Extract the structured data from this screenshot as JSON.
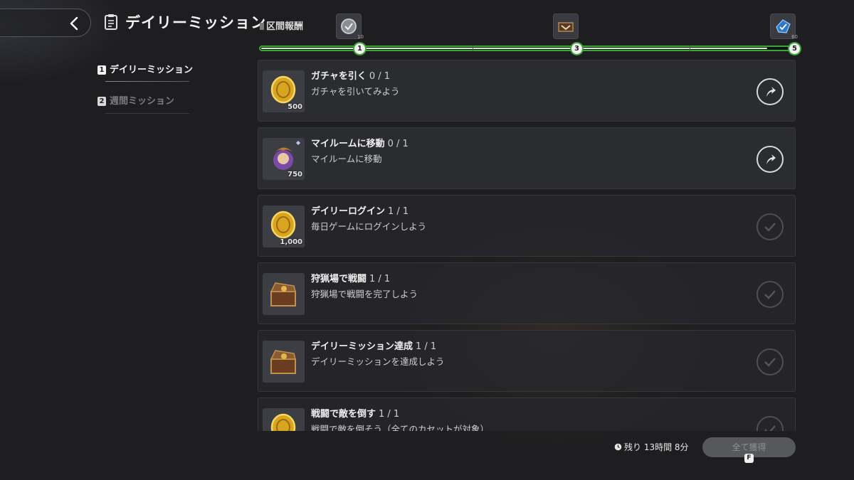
{
  "header": {
    "title": "デイリーミッション",
    "section_label": "区間報酬"
  },
  "progress": {
    "current": 1,
    "max": 5,
    "milestones": [
      {
        "label": "1",
        "reward_icon": "silver-medal-icon",
        "qty": "10"
      },
      {
        "label": "3",
        "reward_icon": "treasure-box-icon",
        "qty": ""
      },
      {
        "label": "5",
        "reward_icon": "blue-crystal-icon",
        "qty": "60"
      }
    ]
  },
  "sidebar": {
    "tabs": [
      {
        "num": "1",
        "label": "デイリーミッション",
        "active": true
      },
      {
        "num": "2",
        "label": "週間ミッション",
        "active": false
      }
    ]
  },
  "missions": [
    {
      "title": "ガチャを引く",
      "progress": "0 / 1",
      "desc": "ガチャを引いてみよう",
      "reward_icon": "gold-coin-icon",
      "qty": "500",
      "state": "go"
    },
    {
      "title": "マイルームに移動",
      "progress": "0 / 1",
      "desc": "マイルームに移動",
      "reward_icon": "character-portrait-icon",
      "qty": "750",
      "state": "go"
    },
    {
      "title": "デイリーログイン",
      "progress": "1 / 1",
      "desc": "毎日ゲームにログインしよう",
      "reward_icon": "gold-coin-icon",
      "qty": "1,000",
      "state": "done"
    },
    {
      "title": "狩猟場で戦闘",
      "progress": "1 / 1",
      "desc": "狩猟場で戦闘を完了しよう",
      "reward_icon": "treasure-box-icon",
      "qty": "",
      "state": "done"
    },
    {
      "title": "デイリーミッション達成",
      "progress": "1 / 1",
      "desc": "デイリーミッションを達成しよう",
      "reward_icon": "treasure-box-icon",
      "qty": "",
      "state": "done"
    },
    {
      "title": "戦闘で敵を倒す",
      "progress": "1 / 1",
      "desc": "戦闘で敵を倒そう（全てのカセットが対象）",
      "reward_icon": "gold-coin-icon",
      "qty": "",
      "state": "done"
    }
  ],
  "footer": {
    "timer": "残り 13時間 8分",
    "claim_all": "全て獲得",
    "claim_key": "F"
  },
  "colors": {
    "accent_green": "#3fa43a",
    "background": "#1e1e21"
  }
}
